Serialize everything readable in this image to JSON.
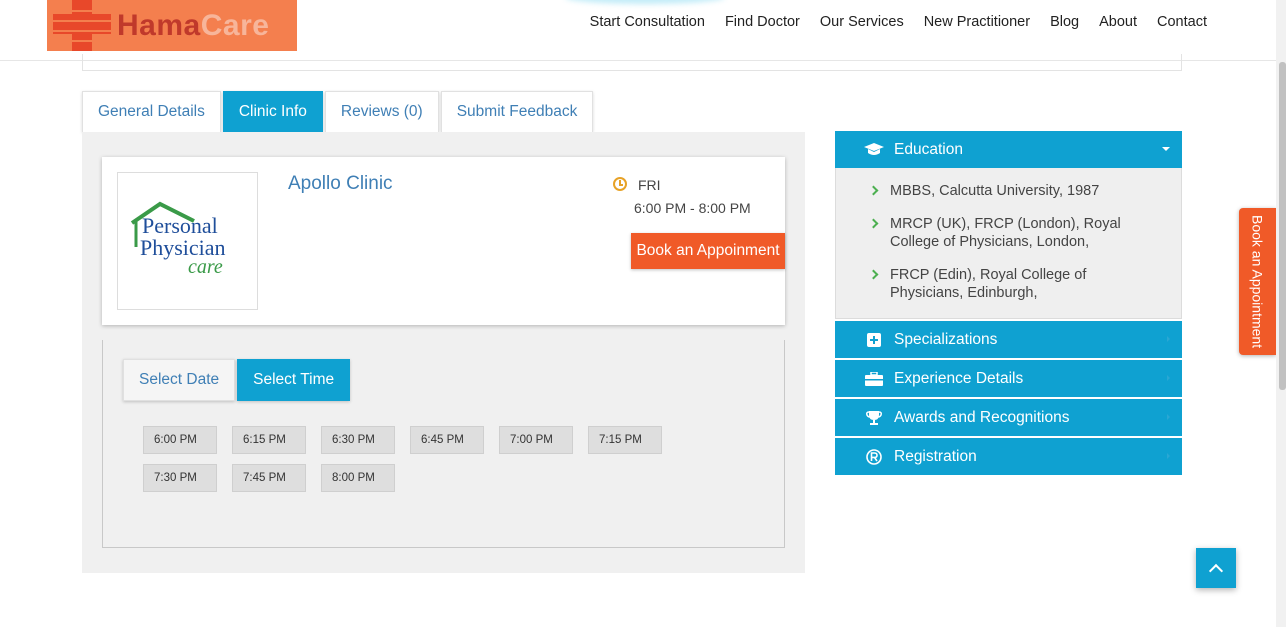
{
  "logo": {
    "part1": "Hama",
    "part2": "Care"
  },
  "nav": [
    "Start Consultation",
    "Find Doctor",
    "Our Services",
    "New Practitioner",
    "Blog",
    "About",
    "Contact"
  ],
  "tabs": [
    {
      "label": "General Details",
      "active": false
    },
    {
      "label": "Clinic Info",
      "active": true
    },
    {
      "label": "Reviews (0)",
      "active": false
    },
    {
      "label": "Submit Feedback",
      "active": false
    }
  ],
  "clinic": {
    "name": "Apollo Clinic",
    "logo_text": {
      "line1": "Personal",
      "line2": "Physician",
      "line3": "care"
    },
    "day": "FRI",
    "hours": "6:00 PM - 8:00 PM",
    "book_label": "Book an Appoinment"
  },
  "booking": {
    "subtabs": [
      {
        "label": "Select Date",
        "active": false
      },
      {
        "label": "Select Time",
        "active": true
      }
    ],
    "slots": [
      "6:00 PM",
      "6:15 PM",
      "6:30 PM",
      "6:45 PM",
      "7:00 PM",
      "7:15 PM",
      "7:30 PM",
      "7:45 PM",
      "8:00 PM"
    ]
  },
  "sidebar": {
    "education": {
      "title": "Education",
      "items": [
        "MBBS, Calcutta University, 1987",
        "MRCP (UK), FRCP (London), Royal College of Physicians, London,",
        "FRCP (Edin), Royal College of Physicians, Edinburgh,"
      ]
    },
    "sections": [
      {
        "title": "Specializations",
        "icon": "plus-square-icon"
      },
      {
        "title": "Experience Details",
        "icon": "briefcase-icon"
      },
      {
        "title": "Awards and Recognitions",
        "icon": "trophy-icon"
      },
      {
        "title": "Registration",
        "icon": "registered-icon"
      }
    ]
  },
  "side_button": "Book an Appointment",
  "colors": {
    "primary": "#0fa1d1",
    "accent": "#f05a28",
    "link": "#3f7fb5"
  }
}
